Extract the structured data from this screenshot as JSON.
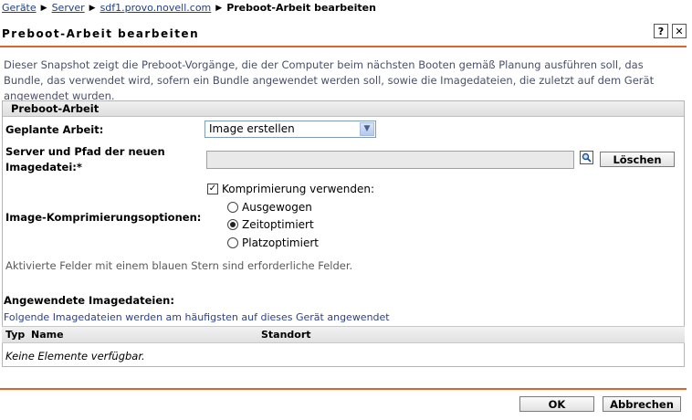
{
  "breadcrumb": {
    "items": [
      "Geräte",
      "Server",
      "sdf1.provo.novell.com"
    ],
    "current": "Preboot-Arbeit bearbeiten"
  },
  "page_title": "Preboot-Arbeit bearbeiten",
  "toolbar": {
    "help_label": "?",
    "close_label": "✕"
  },
  "description": "Dieser Snapshot zeigt die Preboot-Vorgänge, die der Computer beim nächsten Booten gemäß Planung ausführen soll, das Bundle, das verwendet wird, sofern ein Bundle angewendet werden soll, sowie die Imagedateien, die zuletzt auf dem Gerät angewendet wurden.",
  "panel": {
    "title": "Preboot-Arbeit",
    "scheduled_label": "Geplante Arbeit:",
    "scheduled_value": "Image erstellen",
    "server_label_1": "Server und Pfad der neuen",
    "server_label_2": "Imagedatei:*",
    "server_value": "",
    "clear_button": "Löschen",
    "compression_label": "Image-Komprimierungsoptionen:",
    "use_compression": "Komprimierung verwenden:",
    "use_compression_checked": true,
    "options": [
      "Ausgewogen",
      "Zeitoptimiert",
      "Platzoptimiert"
    ],
    "selected_option": "Zeitoptimiert",
    "required_note": "Aktivierte Felder mit einem blauen Stern sind erforderliche Felder.",
    "applied_title": "Angewendete Imagedateien:",
    "applied_sub": "Folgende Imagedateien werden am häufigsten auf dieses Gerät angewendet",
    "columns": [
      "Typ",
      "Name",
      "Standort"
    ],
    "empty_text": "Keine Elemente verfügbar."
  },
  "footer": {
    "ok_label": "OK",
    "cancel_label": "Abbrechen"
  },
  "colors": {
    "accent": "#d9652a",
    "link": "#1f3f7f",
    "description": "#4a4f6a"
  }
}
